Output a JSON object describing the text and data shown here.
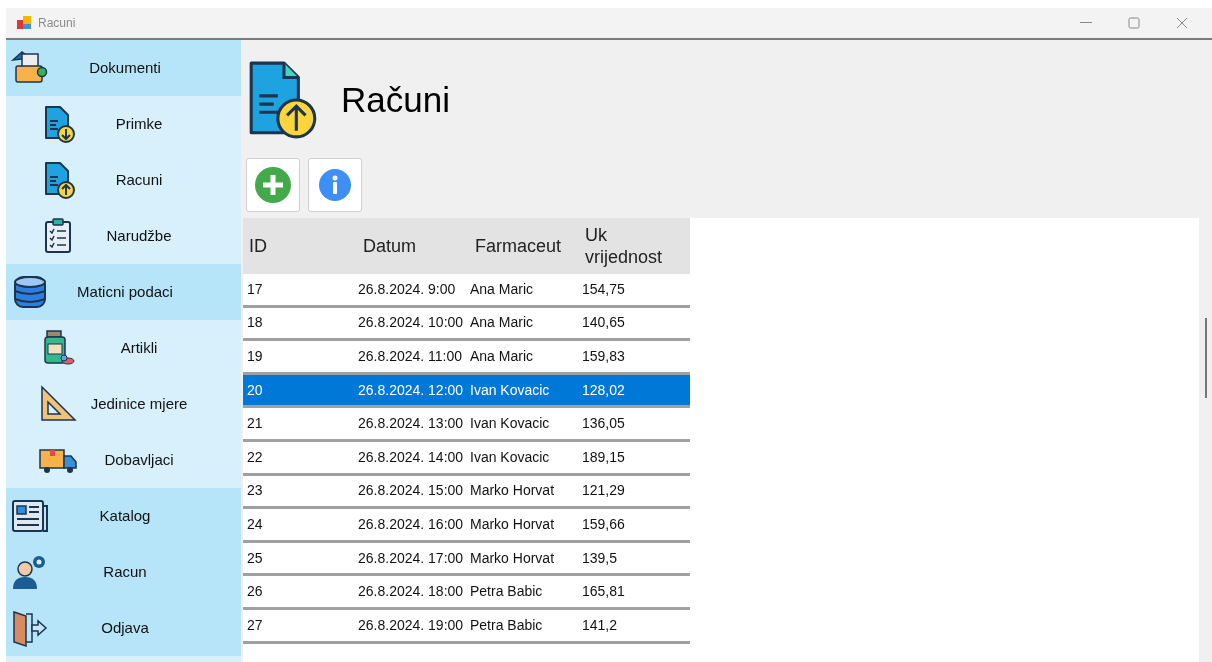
{
  "window": {
    "title": "Racuni"
  },
  "sidebar": {
    "items": [
      {
        "kind": "group",
        "label": "Dokumenti"
      },
      {
        "kind": "sub",
        "label": "Primke"
      },
      {
        "kind": "sub",
        "label": "Racuni"
      },
      {
        "kind": "sub",
        "label": "Narudžbe"
      },
      {
        "kind": "group",
        "label": "Maticni podaci"
      },
      {
        "kind": "sub",
        "label": "Artikli"
      },
      {
        "kind": "sub",
        "label": "Jedinice mjere"
      },
      {
        "kind": "sub",
        "label": "Dobavljaci"
      },
      {
        "kind": "group",
        "label": "Katalog"
      },
      {
        "kind": "group",
        "label": "Racun"
      },
      {
        "kind": "group",
        "label": "Odjava"
      }
    ]
  },
  "page": {
    "title": "Računi"
  },
  "table": {
    "columns": [
      "ID",
      "Datum",
      "Farmaceut",
      "Uk vrijednost"
    ],
    "rows": [
      {
        "cells": [
          "17",
          "26.8.2024. 9:00",
          "Ana Maric",
          "154,75"
        ],
        "selected": false
      },
      {
        "cells": [
          "18",
          "26.8.2024. 10:00",
          "Ana Maric",
          "140,65"
        ],
        "selected": false
      },
      {
        "cells": [
          "19",
          "26.8.2024. 11:00",
          "Ana Maric",
          "159,83"
        ],
        "selected": false
      },
      {
        "cells": [
          "20",
          "26.8.2024. 12:00",
          "Ivan Kovacic",
          "128,02"
        ],
        "selected": true
      },
      {
        "cells": [
          "21",
          "26.8.2024. 13:00",
          "Ivan Kovacic",
          "136,05"
        ],
        "selected": false
      },
      {
        "cells": [
          "22",
          "26.8.2024. 14:00",
          "Ivan Kovacic",
          "189,15"
        ],
        "selected": false
      },
      {
        "cells": [
          "23",
          "26.8.2024. 15:00",
          "Marko Horvat",
          "121,29"
        ],
        "selected": false
      },
      {
        "cells": [
          "24",
          "26.8.2024. 16:00",
          "Marko Horvat",
          "159,66"
        ],
        "selected": false
      },
      {
        "cells": [
          "25",
          "26.8.2024. 17:00",
          "Marko Horvat",
          "139,5"
        ],
        "selected": false
      },
      {
        "cells": [
          "26",
          "26.8.2024. 18:00",
          "Petra Babic",
          "165,81"
        ],
        "selected": false
      },
      {
        "cells": [
          "27",
          "26.8.2024. 19:00",
          "Petra Babic",
          "141,2"
        ],
        "selected": false
      }
    ]
  }
}
